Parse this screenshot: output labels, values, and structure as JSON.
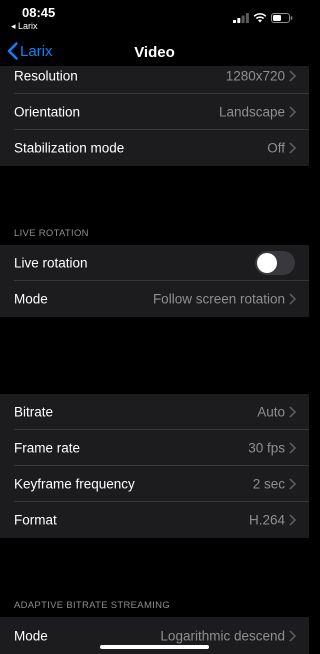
{
  "status_bar": {
    "time": "08:45",
    "back_app": "◂ Larix",
    "icons": [
      "signal-icon",
      "wifi-icon",
      "battery-icon"
    ]
  },
  "nav": {
    "back_label": "Larix",
    "title": "Video"
  },
  "sections": {
    "general": [
      {
        "label": "Resolution",
        "value": "1280x720"
      },
      {
        "label": "Orientation",
        "value": "Landscape"
      },
      {
        "label": "Stabilization mode",
        "value": "Off"
      }
    ],
    "live_rotation": {
      "header": "LIVE ROTATION",
      "toggle_label": "Live rotation",
      "toggle_on": false,
      "mode_label": "Mode",
      "mode_value": "Follow screen rotation"
    },
    "encoding": [
      {
        "label": "Bitrate",
        "value": "Auto"
      },
      {
        "label": "Frame rate",
        "value": "30 fps"
      },
      {
        "label": "Keyframe frequency",
        "value": "2 sec"
      },
      {
        "label": "Format",
        "value": "H.264"
      }
    ],
    "adaptive": {
      "header": "ADAPTIVE BITRATE STREAMING",
      "mode_label": "Mode",
      "mode_value": "Logarithmic descend"
    }
  },
  "colors": {
    "accent": "#0a84ff",
    "row_bg": "#1c1c1e",
    "background": "#000000",
    "secondary_text": "#8e8e93"
  }
}
